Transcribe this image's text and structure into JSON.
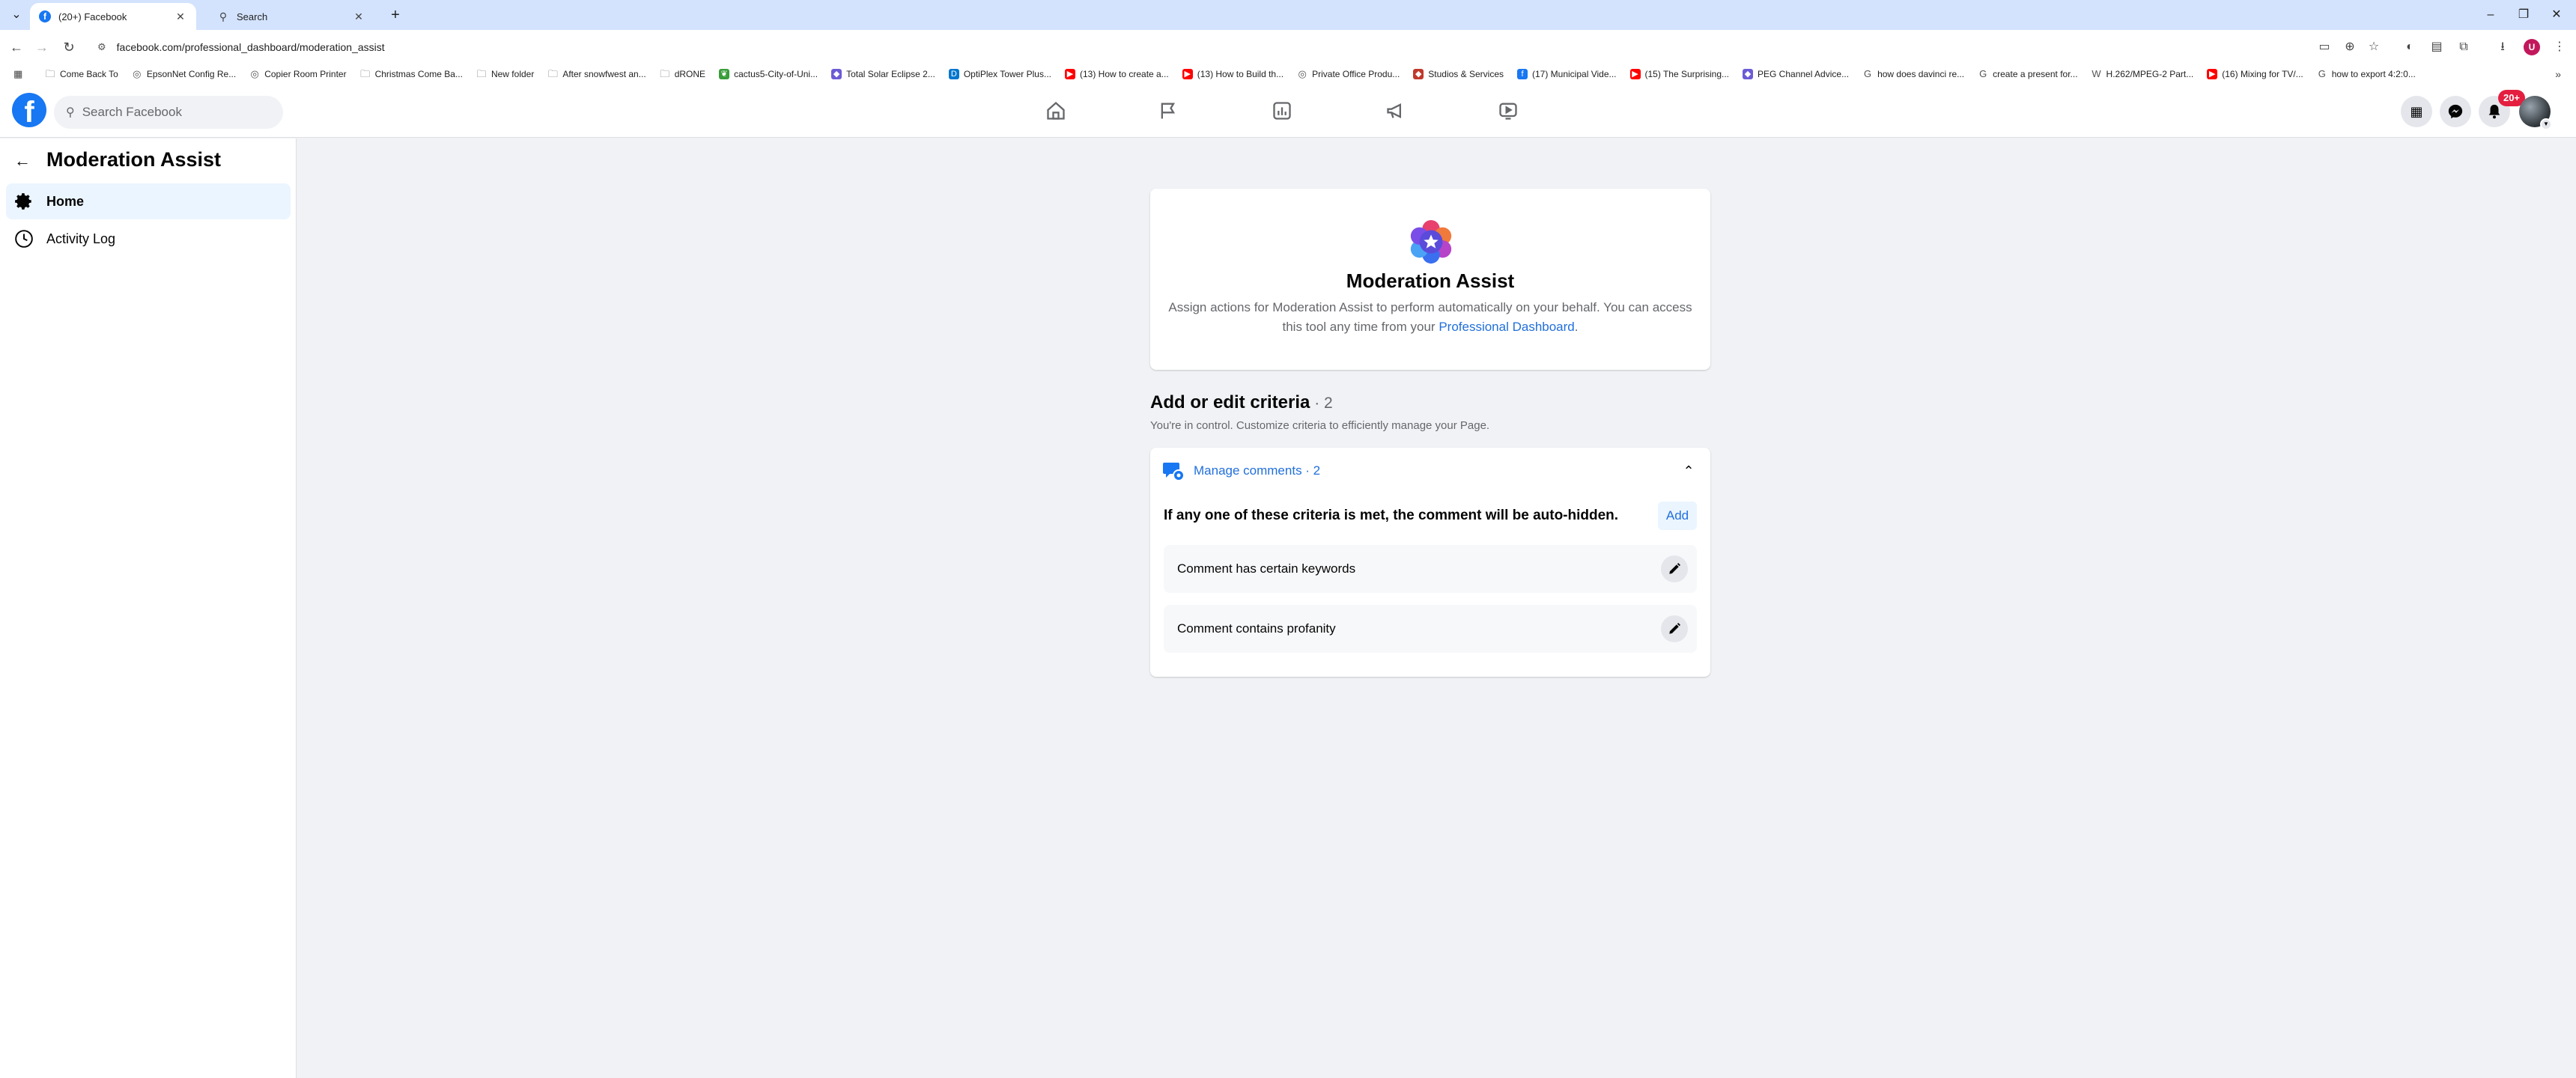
{
  "browser": {
    "tabs": [
      {
        "title": "(20+) Facebook",
        "active": true,
        "icon": "facebook-icon"
      },
      {
        "title": "Search",
        "active": false,
        "icon": "search-icon"
      }
    ],
    "url": "facebook.com/professional_dashboard/moderation_assist",
    "profile_initial": "U",
    "bookmarks": [
      {
        "label": "Come Back To",
        "icon": "folder-icon"
      },
      {
        "label": "EpsonNet Config Re...",
        "icon": "globe-icon"
      },
      {
        "label": "Copier Room Printer",
        "icon": "globe-icon"
      },
      {
        "label": "Christmas Come Ba...",
        "icon": "folder-icon"
      },
      {
        "label": "New folder",
        "icon": "folder-icon"
      },
      {
        "label": "After snowfwest an...",
        "icon": "folder-icon"
      },
      {
        "label": "dRONE",
        "icon": "folder-icon"
      },
      {
        "label": "cactus5-City-of-Uni...",
        "icon": "leaf-icon"
      },
      {
        "label": "Total Solar Eclipse 2...",
        "icon": "site-icon"
      },
      {
        "label": "OptiPlex Tower Plus...",
        "icon": "dell-icon"
      },
      {
        "label": "(13) How to create a...",
        "icon": "youtube-icon"
      },
      {
        "label": "(13) How to Build th...",
        "icon": "youtube-icon"
      },
      {
        "label": "Private Office Produ...",
        "icon": "globe-icon"
      },
      {
        "label": "Studios & Services",
        "icon": "diamond-icon"
      },
      {
        "label": "(17) Municipal Vide...",
        "icon": "facebook-icon"
      },
      {
        "label": "(15) The Surprising...",
        "icon": "youtube-icon"
      },
      {
        "label": "PEG Channel Advice...",
        "icon": "site-icon"
      },
      {
        "label": "how does davinci re...",
        "icon": "google-icon"
      },
      {
        "label": "create a present for...",
        "icon": "google-icon"
      },
      {
        "label": "H.262/MPEG-2 Part...",
        "icon": "wikipedia-icon"
      },
      {
        "label": "(16) Mixing for TV/...",
        "icon": "youtube-icon"
      },
      {
        "label": "how to export 4:2:0...",
        "icon": "google-icon"
      }
    ]
  },
  "fb": {
    "search_placeholder": "Search Facebook",
    "notification_badge": "20+"
  },
  "sidebar": {
    "title": "Moderation Assist",
    "items": [
      {
        "label": "Home",
        "active": true
      },
      {
        "label": "Activity Log",
        "active": false
      }
    ]
  },
  "hero": {
    "title": "Moderation Assist",
    "desc_before": "Assign actions for Moderation Assist to perform automatically on your behalf. You can access this tool any time from your ",
    "desc_link": "Professional Dashboard",
    "desc_after": "."
  },
  "criteria_section": {
    "title": "Add or edit criteria",
    "count": " · 2",
    "subtitle": "You're in control. Customize criteria to efficiently manage your Page.",
    "group_label": "Manage comments · 2",
    "rule_text": "If any one of these criteria is met, the comment will be auto-hidden.",
    "add_label": "Add",
    "rows": [
      {
        "label": "Comment has certain keywords"
      },
      {
        "label": "Comment contains profanity"
      }
    ]
  },
  "colors": {
    "accent": "#1877f2",
    "link": "#216fdb",
    "active_bg": "#ebf5ff",
    "page_bg": "#f0f2f5",
    "badge": "#e41e3f"
  }
}
